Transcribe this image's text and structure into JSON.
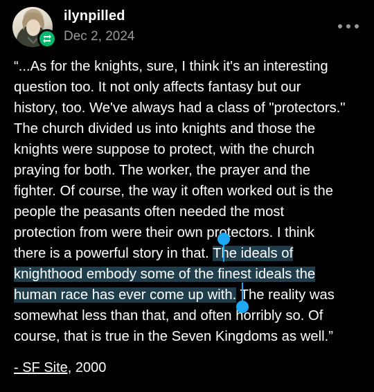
{
  "post": {
    "username": "ilynpilled",
    "date": "Dec 2, 2024",
    "more_icon": "more-dots-icon",
    "reblog_icon": "reblog-icon",
    "quote_lines": [
      "“...As for the knights, sure, I think it's an interesting",
      "question too. It not only affects fantasy but our",
      "history, too. We've always had a class of \"protectors.\"",
      "The church divided us into knights and those the",
      "knights were suppose to protect, with the church",
      "praying for both. The worker, the prayer and the",
      "fighter. Of course, the way it often worked out is the",
      "people the peasants often needed the most",
      "protection from were their own protectors. I think"
    ],
    "line10_before": "there is a powerful story in that. ",
    "line10_selected": "The ideals of",
    "line11_selected": "knighthood embody some of the finest ideals the",
    "line12_selected": "human race has ever come up with.",
    "line12_after": " The reality was",
    "quote_lines_end": [
      "somewhat less than that, and often horribly so. Of",
      "course, that is true in the Seven Kingdoms as well.”"
    ],
    "source_link": "- SF Site,",
    "source_year": " 2000"
  },
  "colors": {
    "background": "#000000",
    "selection": "#1f3d4a",
    "selection_handle": "#1ea7f5",
    "reblog_badge": "#00b86b",
    "muted_text": "#9a9a9a"
  }
}
